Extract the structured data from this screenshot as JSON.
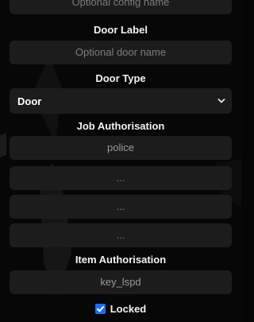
{
  "config": {
    "name_placeholder": "Optional config name"
  },
  "door_label": {
    "label": "Door Label",
    "placeholder": "Optional door name"
  },
  "door_type": {
    "label": "Door Type",
    "selected": "Door",
    "icon": "chevron-down-icon"
  },
  "job_authorisation": {
    "label": "Job Authorisation",
    "fields": [
      {
        "value": "police",
        "placeholder": "..."
      },
      {
        "value": "",
        "placeholder": "..."
      },
      {
        "value": "",
        "placeholder": "..."
      },
      {
        "value": "",
        "placeholder": "..."
      }
    ]
  },
  "item_authorisation": {
    "label": "Item Authorisation",
    "value": "key_lspd"
  },
  "locked": {
    "label": "Locked",
    "checked": true,
    "accent": "#1f6feb"
  }
}
